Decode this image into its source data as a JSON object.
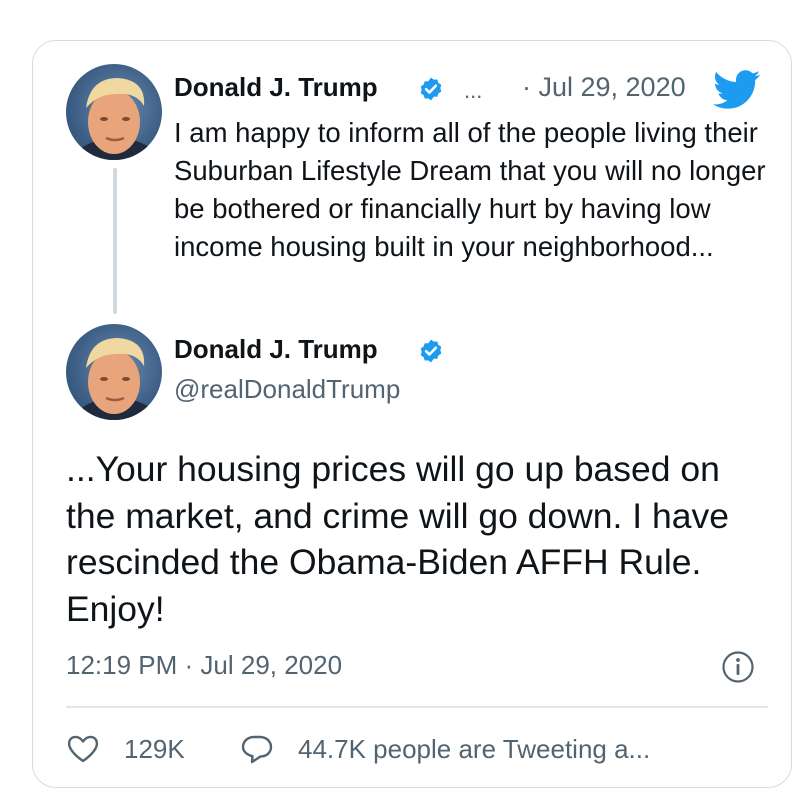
{
  "thread_tweet": {
    "author_name": "Donald J. Trump",
    "more_dots": "...",
    "date": "· Jul 29, 2020",
    "text": "I am happy to inform all of the people living their Suburban Lifestyle Dream that you will no longer be bothered or financially hurt by having low income housing built in your neighborhood..."
  },
  "main_tweet": {
    "author_name": "Donald J. Trump",
    "handle": "@realDonaldTrump",
    "text": "...Your housing prices will go up based on the market, and crime will go down. I have rescinded the Obama-Biden AFFH Rule. Enjoy!",
    "timestamp": "12:19 PM · Jul 29, 2020"
  },
  "actions": {
    "like_count": "129K",
    "reply_text": "44.7K people are Tweeting a..."
  },
  "icons": {
    "brand": "twitter-bird-icon",
    "verified": "verified-badge-icon",
    "info": "info-icon",
    "like": "heart-icon",
    "reply": "speech-bubble-icon"
  },
  "colors": {
    "brand_blue": "#1d9bf0",
    "text": "#0f1419",
    "muted": "#536471",
    "border": "#d6dbe0"
  }
}
